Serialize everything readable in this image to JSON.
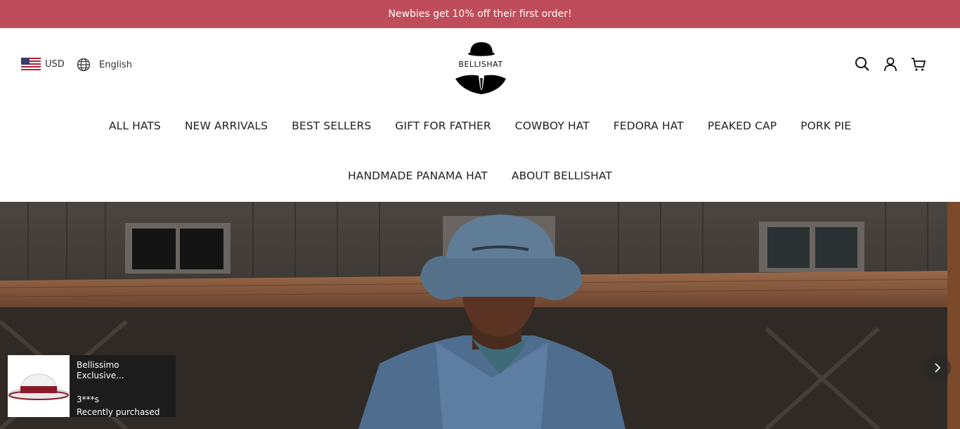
{
  "announcement": "Newbies get 10% off their first order!",
  "header": {
    "currency": "USD",
    "language": "English",
    "logo_text": "BELLISHAT",
    "icons": [
      "search-icon",
      "account-icon",
      "cart-icon"
    ]
  },
  "nav": {
    "row1": [
      "ALL HATS",
      "NEW ARRIVALS",
      "BEST SELLERS",
      "GIFT FOR FATHER",
      "COWBOY HAT",
      "FEDORA HAT",
      "PEAKED CAP",
      "PORK PIE"
    ],
    "row2": [
      "HANDMADE PANAMA HAT",
      "ABOUT BELLISHAT"
    ]
  },
  "toast": {
    "product": "Bellissimo Exclusive...",
    "buyer": "3***s",
    "status": "Recently purchased"
  },
  "colors": {
    "announcement_bg": "#bf4c5a",
    "toast_bg": "#1c1c1c"
  }
}
